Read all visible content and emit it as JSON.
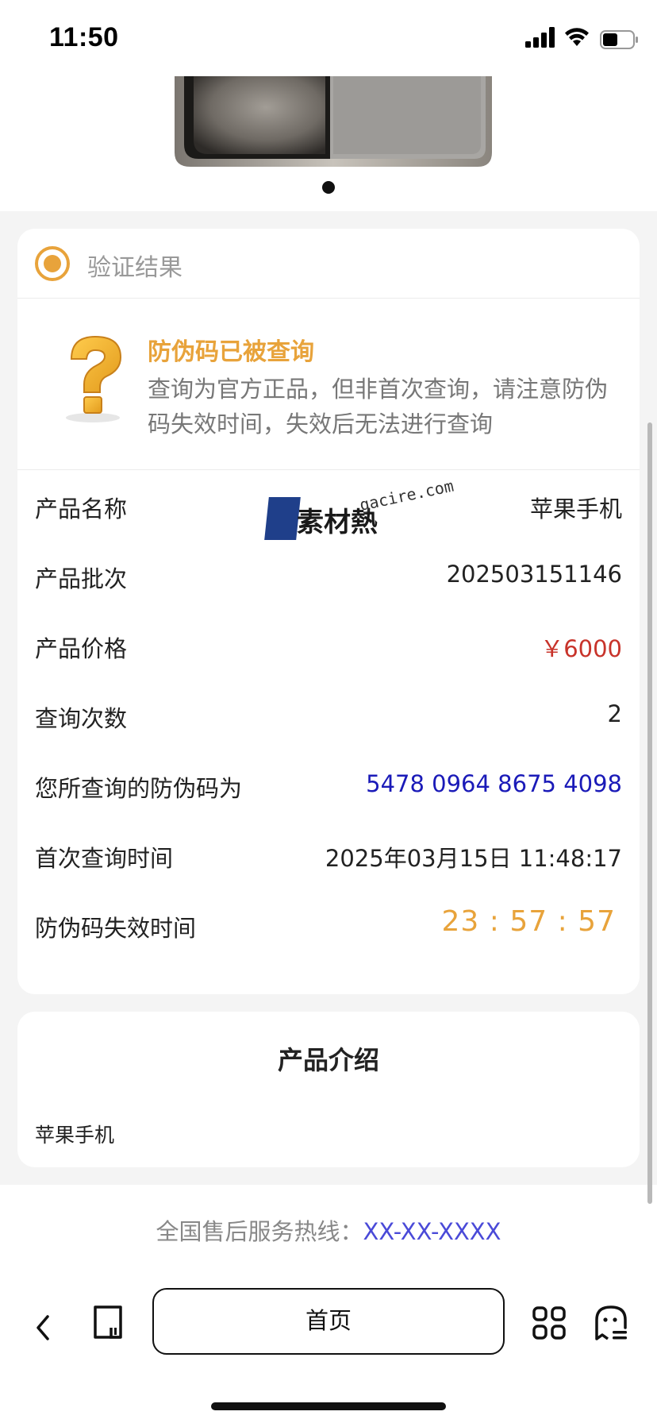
{
  "status_bar": {
    "time": "11:50"
  },
  "result": {
    "header_title": "验证结果",
    "notice_title": "防伪码已被查询",
    "notice_desc": "查询为官方正品，但非首次查询，请注意防伪码失效时间，失效后无法进行查询",
    "rows": [
      {
        "label": "产品名称",
        "value": "苹果手机"
      },
      {
        "label": "产品批次",
        "value": "202503151146"
      },
      {
        "label": "产品价格",
        "value": "￥6000"
      },
      {
        "label": "查询次数",
        "value": "2"
      },
      {
        "label": "您所查询的防伪码为",
        "value": "5478 0964 8675 4098"
      },
      {
        "label": "首次查询时间",
        "value": "2025年03月15日 11:48:17"
      },
      {
        "label": "防伪码失效时间",
        "value": "23 : 57 : 57"
      }
    ],
    "colors": {
      "accent": "#e8a33b",
      "price": "#c8332a",
      "code": "#1a1ab8"
    }
  },
  "watermark": {
    "text": "素材熱",
    "domain": "gacire.com"
  },
  "intro": {
    "title": "产品介绍",
    "text": "苹果手机"
  },
  "footer": {
    "hotline_label": "全国售后服务热线：",
    "hotline_number": "XX-XX-XXXX"
  },
  "toolbar": {
    "home_label": "首页"
  }
}
